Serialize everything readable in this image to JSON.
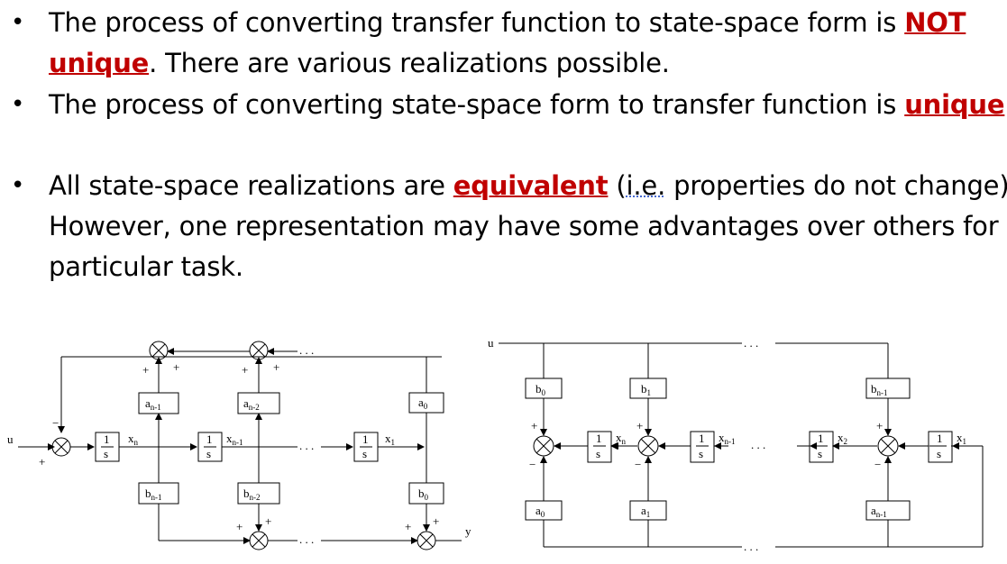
{
  "bullets": [
    {
      "text_a": "The process of converting transfer function to state-space form is ",
      "highlight": "NOT unique",
      "text_b": ". There are various realizations possible."
    },
    {
      "text_a": "The process of converting state-space form to transfer function is ",
      "highlight": "unique",
      "text_b": "."
    },
    {
      "text_a": "All state-space realizations are ",
      "highlight": "equivalent",
      "text_c": " (",
      "abbr": "i.e.",
      "text_b": " properties do not change). However, one representation may have some advantages over others for a particular task."
    }
  ],
  "left_diagram": {
    "input": "u",
    "output": "y",
    "integrator_top": "1",
    "integrator_bottom": "s",
    "a_blocks": [
      "a",
      "a",
      "a"
    ],
    "a_subs": [
      "n-1",
      "n-2",
      "0"
    ],
    "b_blocks": [
      "b",
      "b",
      "b"
    ],
    "b_subs": [
      "n-1",
      "n-2",
      "0"
    ],
    "states": [
      "x",
      "x",
      "x"
    ],
    "state_subs": [
      "n",
      "n-1",
      "1"
    ],
    "plus": "+",
    "minus": "−",
    "ellipsis": ". . ."
  },
  "right_diagram": {
    "input": "u",
    "integrator_top": "1",
    "integrator_bottom": "s",
    "b_blocks": [
      "b",
      "b",
      "b"
    ],
    "b_subs": [
      "0",
      "1",
      "n-1"
    ],
    "a_blocks": [
      "a",
      "a",
      "a"
    ],
    "a_subs": [
      "0",
      "1",
      "n-1"
    ],
    "states": [
      "x",
      "x",
      "x",
      "x"
    ],
    "state_subs": [
      "n",
      "n-1",
      "2",
      "1"
    ],
    "plus": "+",
    "minus": "−",
    "ellipsis": ". . ."
  }
}
